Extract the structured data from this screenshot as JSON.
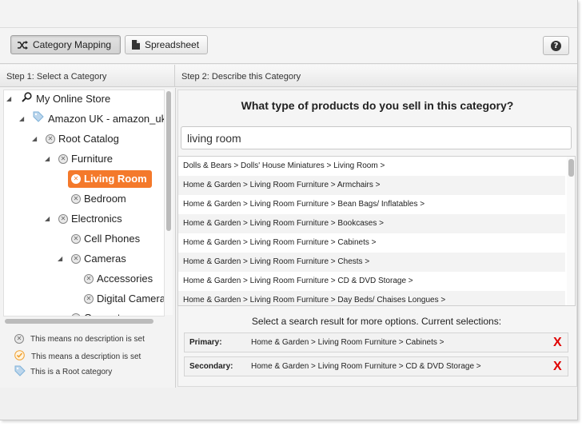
{
  "toolbar": {
    "category_mapping_label": "Category Mapping",
    "spreadsheet_label": "Spreadsheet",
    "help_label": "?"
  },
  "step1": {
    "header": "Step 1: Select a Category"
  },
  "step2": {
    "header": "Step 2: Describe this Category",
    "question": "What type of products do you sell in this category?"
  },
  "tree": {
    "store": "My Online Store",
    "channel": "Amazon UK - amazon_uk",
    "root_catalog": "Root Catalog",
    "furniture": "Furniture",
    "living_room": "Living Room",
    "bedroom": "Bedroom",
    "electronics": "Electronics",
    "cell_phones": "Cell Phones",
    "cameras": "Cameras",
    "accessories": "Accessories",
    "digital_cameras": "Digital Cameras",
    "computers": "Computers"
  },
  "legend": {
    "no_description": "This means no description is set",
    "description_set": "This means a description is set",
    "root_category": "This is a Root category"
  },
  "search": {
    "value": "living room"
  },
  "results": [
    "Dolls & Bears > Dolls' House Miniatures > Living Room >",
    "Home & Garden > Living Room Furniture > Armchairs >",
    "Home & Garden > Living Room Furniture > Bean Bags/ Inflatables >",
    "Home & Garden > Living Room Furniture > Bookcases >",
    "Home & Garden > Living Room Furniture > Cabinets >",
    "Home & Garden > Living Room Furniture > Chests >",
    "Home & Garden > Living Room Furniture > CD & DVD Storage >",
    "Home & Garden > Living Room Furniture > Day Beds/ Chaises Longues >"
  ],
  "selections": {
    "hint": "Select a search result for more options. Current selections:",
    "primary_label": "Primary:",
    "primary_value": "Home & Garden > Living Room Furniture > Cabinets >",
    "secondary_label": "Secondary:",
    "secondary_value": "Home & Garden > Living Room Furniture > CD & DVD Storage >",
    "remove_label": "X"
  },
  "colors": {
    "selected_node": "#f4792b",
    "remove_x": "#e00000",
    "description_set_check": "#f0a030",
    "root_tag": "#7fb2d9"
  }
}
